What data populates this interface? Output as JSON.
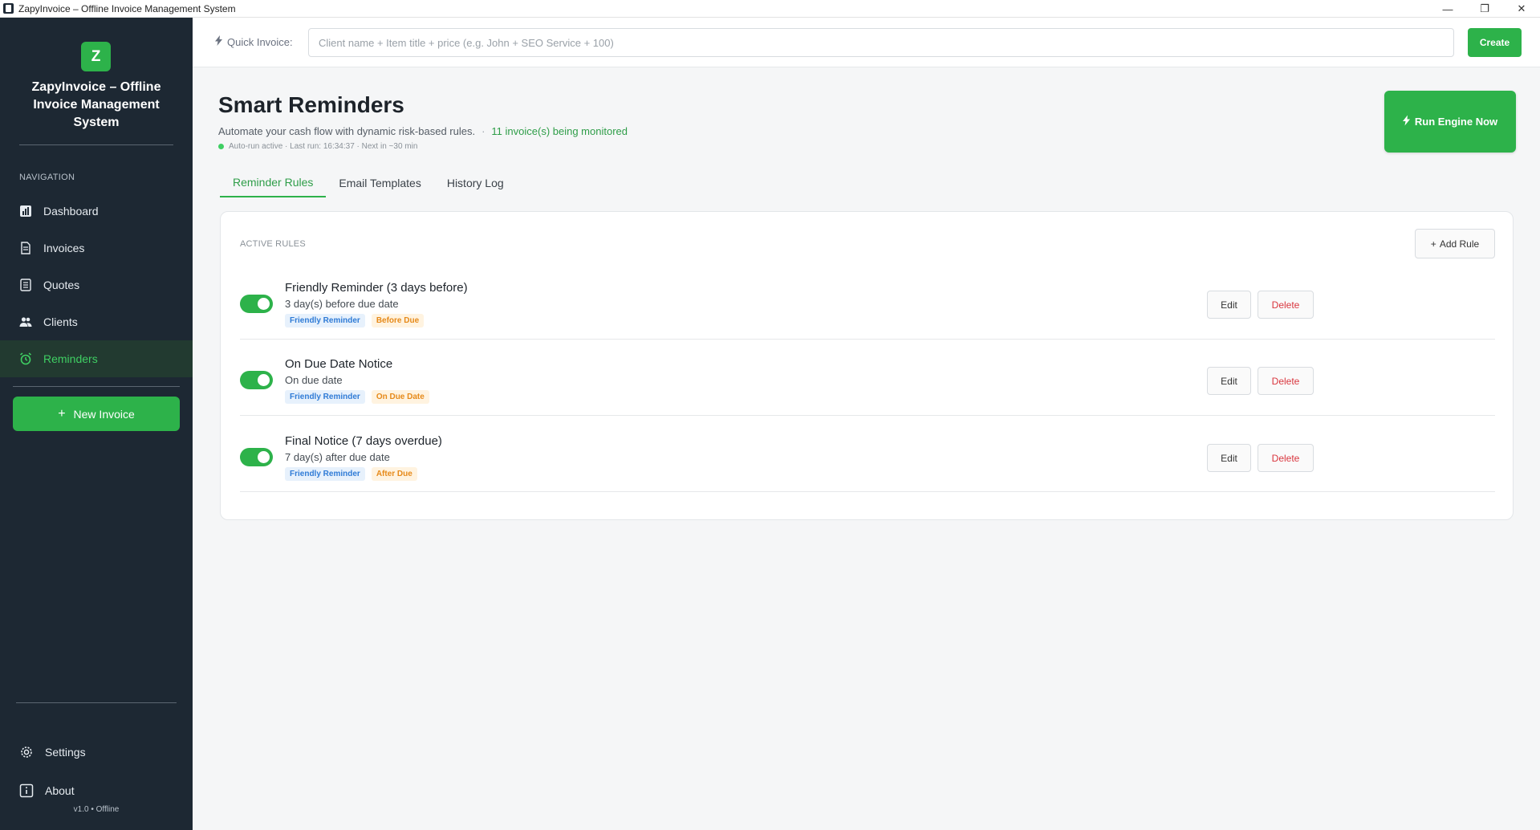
{
  "window": {
    "title": "ZapyInvoice – Offline Invoice Management System",
    "minimize": "—",
    "restore": "❐",
    "close": "✕"
  },
  "sidebar": {
    "logo_letter": "Z",
    "brand_name": "ZapyInvoice – Offline Invoice Management System",
    "nav_heading": "NAVIGATION",
    "items": [
      {
        "label": "Dashboard",
        "icon": "chart-icon"
      },
      {
        "label": "Invoices",
        "icon": "document-icon"
      },
      {
        "label": "Quotes",
        "icon": "clipboard-icon"
      },
      {
        "label": "Clients",
        "icon": "users-icon"
      },
      {
        "label": "Reminders",
        "icon": "alarm-icon",
        "active": true
      }
    ],
    "new_invoice": "New Invoice",
    "footer": [
      {
        "label": "Settings",
        "icon": "gear-icon"
      },
      {
        "label": "About",
        "icon": "info-icon"
      }
    ],
    "version": "v1.0 • Offline"
  },
  "quick_invoice": {
    "label": "Quick Invoice:",
    "placeholder": "Client name + Item title + price (e.g. John + SEO Service + 100)",
    "value": "",
    "create": "Create"
  },
  "main": {
    "title": "Smart Reminders",
    "subtitle": "Automate your cash flow with dynamic risk-based rules.",
    "separator": "·",
    "monitored": "11 invoice(s) being monitored",
    "status": "Auto-run active · Last run: 16:34:37 · Next in ~30 min",
    "run_engine": "Run Engine Now",
    "tabs": [
      {
        "label": "Reminder Rules",
        "active": true
      },
      {
        "label": "Email Templates"
      },
      {
        "label": "History Log"
      }
    ],
    "section_label": "ACTIVE RULES",
    "add_rule": "Add Rule",
    "rules": [
      {
        "title": "Friendly Reminder (3 days before)",
        "desc": "3 day(s) before due date",
        "tags": [
          "Friendly Reminder",
          "Before Due"
        ],
        "enabled": true
      },
      {
        "title": "On Due Date Notice",
        "desc": "On due date",
        "tags": [
          "Friendly Reminder",
          "On Due Date"
        ],
        "enabled": true
      },
      {
        "title": "Final Notice (7 days overdue)",
        "desc": "7 day(s) after due date",
        "tags": [
          "Friendly Reminder",
          "After Due"
        ],
        "enabled": true
      }
    ],
    "edit": "Edit",
    "delete": "Delete"
  },
  "colors": {
    "accent": "#2db24a",
    "sidebar_bg": "#1d2833",
    "danger": "#d9363e",
    "tag_blue": "#2f7bd6",
    "tag_orange": "#e68a1a"
  }
}
